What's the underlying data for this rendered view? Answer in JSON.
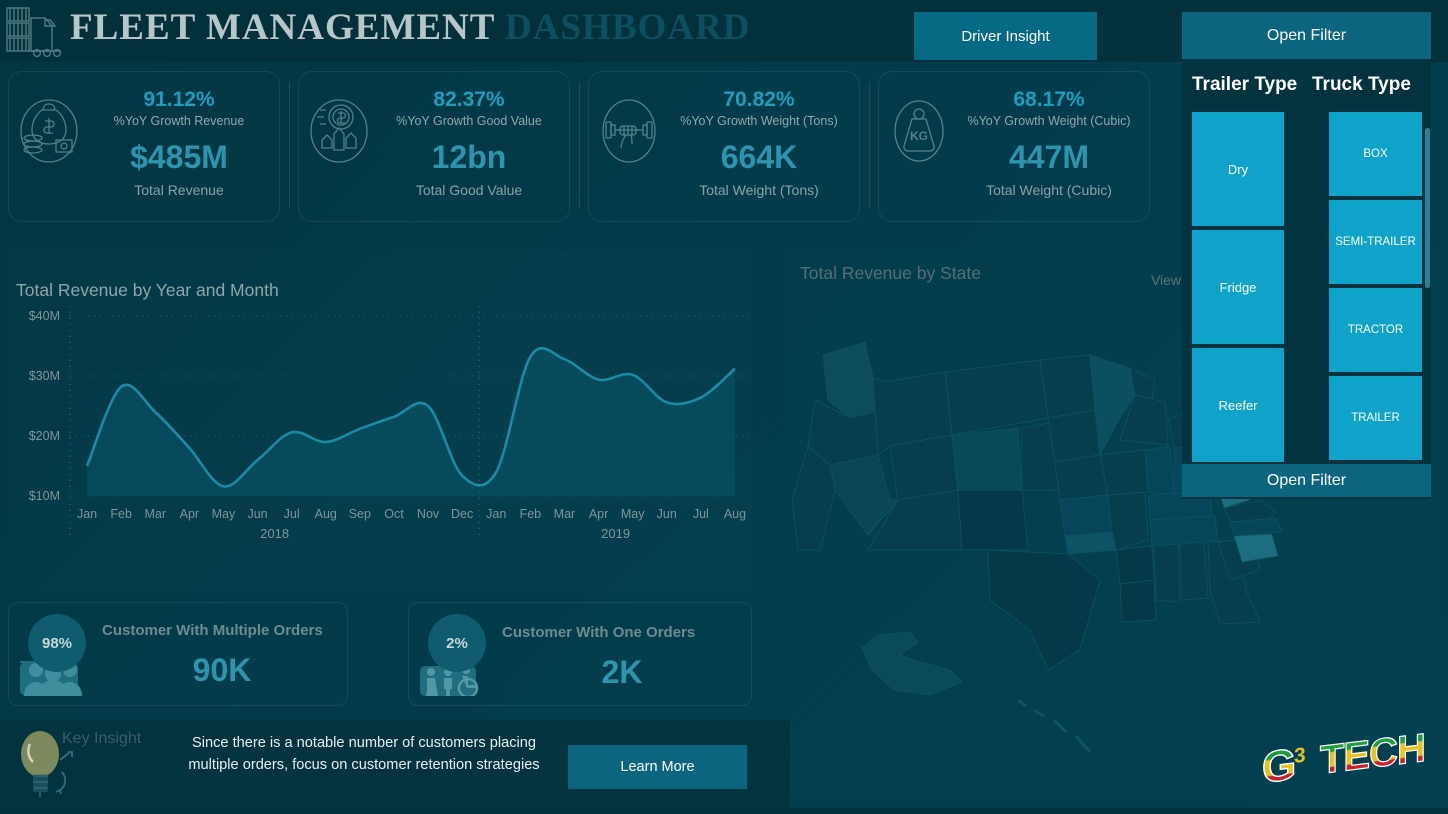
{
  "header": {
    "title_primary": "FLEET MANAGEMENT",
    "title_secondary": "DASHBOARD",
    "truck_icon": "truck-icon",
    "driver_insight_label": "Driver Insight",
    "open_filter_top_label": "Open Filter"
  },
  "kpis": [
    {
      "pct": "91.12%",
      "pct_label": "%YoY Growth Revenue",
      "value": "$485M",
      "value_label": "Total Revenue",
      "icon": "money-bag-icon"
    },
    {
      "pct": "82.37%",
      "pct_label": "%YoY Growth Good Value",
      "value": "12bn",
      "value_label": "Total Good Value",
      "icon": "value-growth-icon"
    },
    {
      "pct": "70.82%",
      "pct_label": "%YoY Growth Weight (Tons)",
      "value": "664K",
      "value_label": "Total Weight (Tons)",
      "icon": "dumbbell-icon"
    },
    {
      "pct": "68.17%",
      "pct_label": "%YoY Growth Weight (Cubic)",
      "value": "447M",
      "value_label": "Total Weight (Cubic)",
      "icon": "kg-weight-icon"
    }
  ],
  "chart_data": {
    "type": "area",
    "title": "Total Revenue by Year and Month",
    "xlabel": "",
    "ylabel": "",
    "ylim": [
      10,
      40
    ],
    "yticks": [
      10,
      20,
      30,
      40
    ],
    "ytick_labels": [
      "$10M",
      "$20M",
      "$30M",
      "$40M"
    ],
    "grid": true,
    "legend": "none",
    "groups": [
      {
        "label": "2018",
        "categories": [
          "Jan",
          "Feb",
          "Mar",
          "Apr",
          "May",
          "Jun",
          "Jul",
          "Aug",
          "Sep",
          "Oct",
          "Nov",
          "Dec"
        ]
      },
      {
        "label": "2019",
        "categories": [
          "Jan",
          "Feb",
          "Mar",
          "Apr",
          "May",
          "Jun",
          "Jul",
          "Aug"
        ]
      }
    ],
    "categories": [
      "Jan",
      "Feb",
      "Mar",
      "Apr",
      "May",
      "Jun",
      "Jul",
      "Aug",
      "Sep",
      "Oct",
      "Nov",
      "Dec",
      "Jan",
      "Feb",
      "Mar",
      "Apr",
      "May",
      "Jun",
      "Jul",
      "Aug"
    ],
    "values": [
      15.0,
      28.2,
      24.0,
      18.0,
      11.6,
      16.0,
      20.6,
      19.0,
      21.2,
      23.2,
      25.0,
      13.4,
      14.0,
      33.2,
      32.8,
      29.4,
      30.2,
      25.6,
      26.4,
      31.2
    ],
    "series": [
      {
        "name": "Total Revenue",
        "values": [
          15.0,
          28.2,
          24.0,
          18.0,
          11.6,
          16.0,
          20.6,
          19.0,
          21.2,
          23.2,
          25.0,
          13.4,
          14.0,
          33.2,
          32.8,
          29.4,
          30.2,
          25.6,
          26.4,
          31.2
        ]
      }
    ],
    "units": "$M",
    "line_color": "#1b8ba5",
    "fill_color": "#064e5f"
  },
  "customer_cards": [
    {
      "badge": "98%",
      "title": "Customer With Multiple Orders",
      "value": "90K",
      "icon": "people-group-icon"
    },
    {
      "badge": "2%",
      "title": "Customer With One Orders",
      "value": "2K",
      "icon": "accessibility-people-icon"
    }
  ],
  "map": {
    "title": "Total Revenue by State",
    "view_revenue_label": "View Revenue"
  },
  "filters": {
    "trailer_type_header": "Trailer Type",
    "truck_type_header": "Truck Type",
    "trailer_types": [
      "Dry",
      "Fridge",
      "Reefer"
    ],
    "truck_types": [
      "BOX",
      "SEMI-TRAILER",
      "TRACTOR",
      "TRAILER"
    ],
    "open_filter_bottom_label": "Open Filter",
    "tile_color": "#0fa3c9"
  },
  "footer": {
    "key_insight_label": "Key Insight",
    "insight_text": "Since there is a notable number of customers placing multiple orders, focus on customer retention strategies",
    "learn_more_label": "Learn More",
    "bulb_icon": "lightbulb-icon"
  },
  "logo": {
    "text_g": "G",
    "text_sup": "3",
    "text_tech": "TECH",
    "color_green": "#1e9e3e",
    "color_yellow": "#e8c11c",
    "color_red": "#c9202a"
  }
}
